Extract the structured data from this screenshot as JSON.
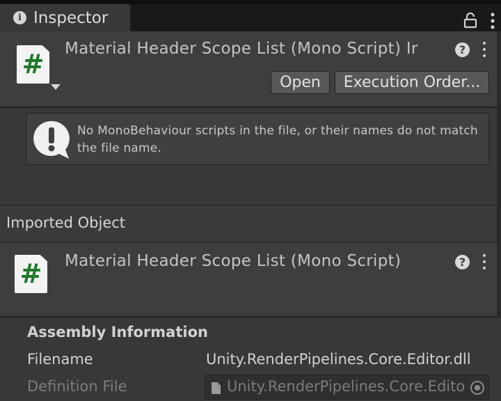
{
  "tab": {
    "title": "Inspector",
    "icon": "info-icon"
  },
  "header": {
    "title": "Material Header Scope List (Mono Script) Ir",
    "icon_glyph": "#",
    "open_label": "Open",
    "execution_order_label": "Execution Order..."
  },
  "helpbox": {
    "message": "No MonoBehaviour scripts in the file, or their names do not match the file name."
  },
  "imported_object": {
    "section_label": "Imported Object",
    "title": "Material Header Scope List (Mono Script)",
    "icon_glyph": "#"
  },
  "assembly": {
    "title": "Assembly Information",
    "filename_label": "Filename",
    "filename_value": "Unity.RenderPipelines.Core.Editor.dll",
    "definition_label": "Definition File",
    "definition_value": "Unity.RenderPipelines.Core.Editor"
  },
  "colors": {
    "background": "#383838",
    "header_background": "#3e3e3e",
    "script_hash": "#1f7a2a",
    "button": "#585858"
  }
}
